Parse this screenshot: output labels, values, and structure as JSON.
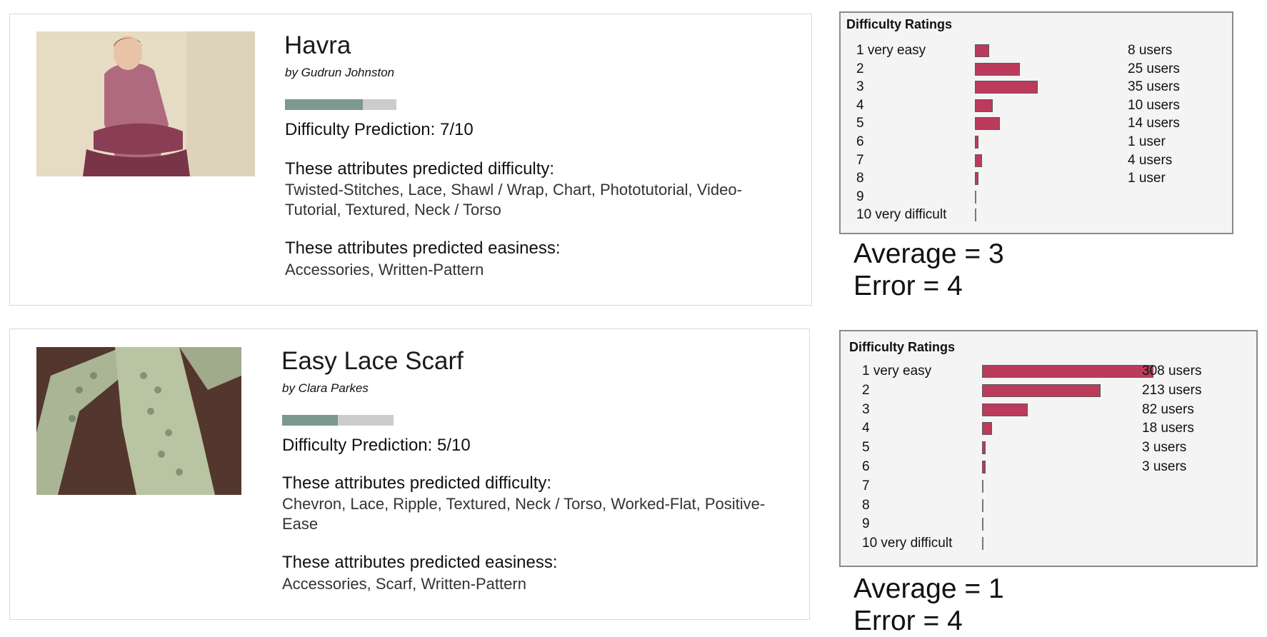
{
  "patterns": [
    {
      "title": "Havra",
      "author": "by Gudrun Johnston",
      "prediction_fraction": 0.7,
      "prediction": "Difficulty Prediction: 7/10",
      "difficulty_heading": "These attributes predicted difficulty:",
      "difficulty_attrs": "Twisted-Stitches, Lace, Shawl / Wrap, Chart, Phototutorial, Video-Tutorial, Textured, Neck / Torso",
      "easiness_heading": "These attributes predicted easiness:",
      "easiness_attrs": "Accessories, Written-Pattern",
      "ratings": {
        "title": "Difficulty Ratings",
        "max_count": 35,
        "rows": [
          {
            "label": "1 very easy",
            "count": 8,
            "count_text": "8 users"
          },
          {
            "label": "2",
            "count": 25,
            "count_text": "25 users"
          },
          {
            "label": "3",
            "count": 35,
            "count_text": "35 users"
          },
          {
            "label": "4",
            "count": 10,
            "count_text": "10 users"
          },
          {
            "label": "5",
            "count": 14,
            "count_text": "14 users"
          },
          {
            "label": "6",
            "count": 1,
            "count_text": "1 user"
          },
          {
            "label": "7",
            "count": 4,
            "count_text": "4 users"
          },
          {
            "label": "8",
            "count": 1,
            "count_text": "1 user"
          },
          {
            "label": "9",
            "count": 0,
            "count_text": ""
          },
          {
            "label": "10 very difficult",
            "count": 0,
            "count_text": ""
          }
        ]
      },
      "average": "Average = 3",
      "error": "Error = 4"
    },
    {
      "title": "Easy Lace Scarf",
      "author": "by Clara Parkes",
      "prediction_fraction": 0.5,
      "prediction": "Difficulty Prediction: 5/10",
      "difficulty_heading": "These attributes predicted difficulty:",
      "difficulty_attrs": "Chevron, Lace, Ripple, Textured, Neck / Torso, Worked-Flat, Positive-Ease",
      "easiness_heading": "These attributes predicted easiness:",
      "easiness_attrs": "Accessories, Scarf, Written-Pattern",
      "ratings": {
        "title": "Difficulty Ratings",
        "max_count": 308,
        "rows": [
          {
            "label": "1 very easy",
            "count": 308,
            "count_text": "308 users"
          },
          {
            "label": "2",
            "count": 213,
            "count_text": "213 users"
          },
          {
            "label": "3",
            "count": 82,
            "count_text": "82 users"
          },
          {
            "label": "4",
            "count": 18,
            "count_text": "18 users"
          },
          {
            "label": "5",
            "count": 3,
            "count_text": "3 users"
          },
          {
            "label": "6",
            "count": 3,
            "count_text": "3 users"
          },
          {
            "label": "7",
            "count": 0,
            "count_text": ""
          },
          {
            "label": "8",
            "count": 0,
            "count_text": ""
          },
          {
            "label": "9",
            "count": 0,
            "count_text": ""
          },
          {
            "label": "10 very difficult",
            "count": 0,
            "count_text": ""
          }
        ]
      },
      "average": "Average = 1",
      "error": "Error = 4"
    }
  ],
  "colors": {
    "rating_bar": "#bb3b5c",
    "prediction_fill": "#7d988c",
    "prediction_track": "#cccccc"
  }
}
